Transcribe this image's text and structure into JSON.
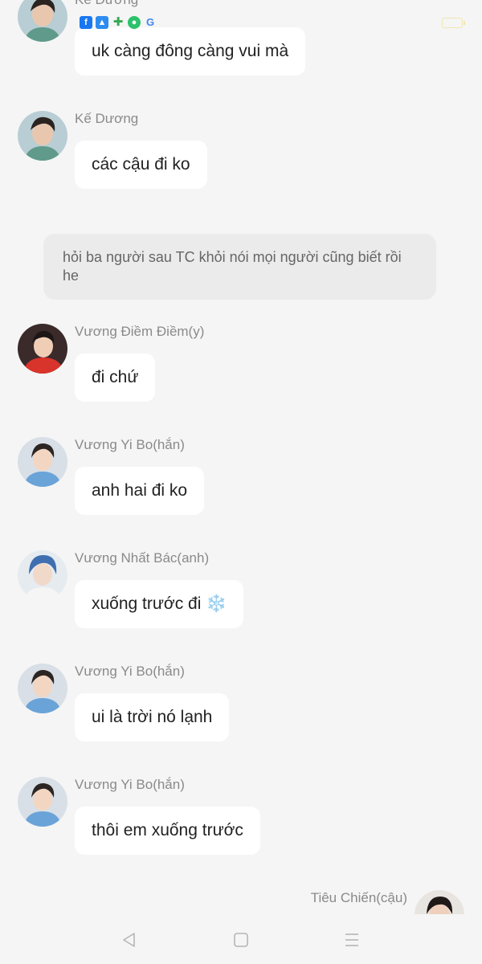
{
  "status_bar": {
    "icons": [
      "facebook-icon",
      "upload-icon",
      "puzzle-icon",
      "chat-icon",
      "google-icon"
    ],
    "battery_color": "#f0e6b0"
  },
  "messages": [
    {
      "sender": "Kế Dương",
      "text": "uk càng đông càng vui mà",
      "avatar": "avatar-ke-duong"
    },
    {
      "sender": "Kế Dương",
      "text": "các cậu đi ko",
      "avatar": "avatar-ke-duong"
    },
    {
      "sender": "Vương Điềm Điềm(y)",
      "text": "đi chứ",
      "avatar": "avatar-vuong-diem-diem"
    },
    {
      "sender": "Vương Yi Bo(hắn)",
      "text": "anh hai đi ko",
      "avatar": "avatar-vuong-yi-bo"
    },
    {
      "sender": "Vương Nhất Bác(anh)",
      "text": "xuống trước đi ❄️",
      "avatar": "avatar-vuong-nhat-bac"
    },
    {
      "sender": "Vương Yi Bo(hắn)",
      "text": "ui là trời nó lạnh",
      "avatar": "avatar-vuong-yi-bo"
    },
    {
      "sender": "Vương Yi Bo(hắn)",
      "text": "thôi em xuống trước",
      "avatar": "avatar-vuong-yi-bo"
    }
  ],
  "system_note": "hỏi ba người sau TC khỏi nói mọi người cũng biết rồi he",
  "self": {
    "sender": "Tiêu Chiến(cậu)"
  },
  "colors": {
    "background": "#f5f5f5",
    "bubble": "#ffffff",
    "note_bg": "#ebebeb",
    "sender_text": "#8a8a8a"
  }
}
